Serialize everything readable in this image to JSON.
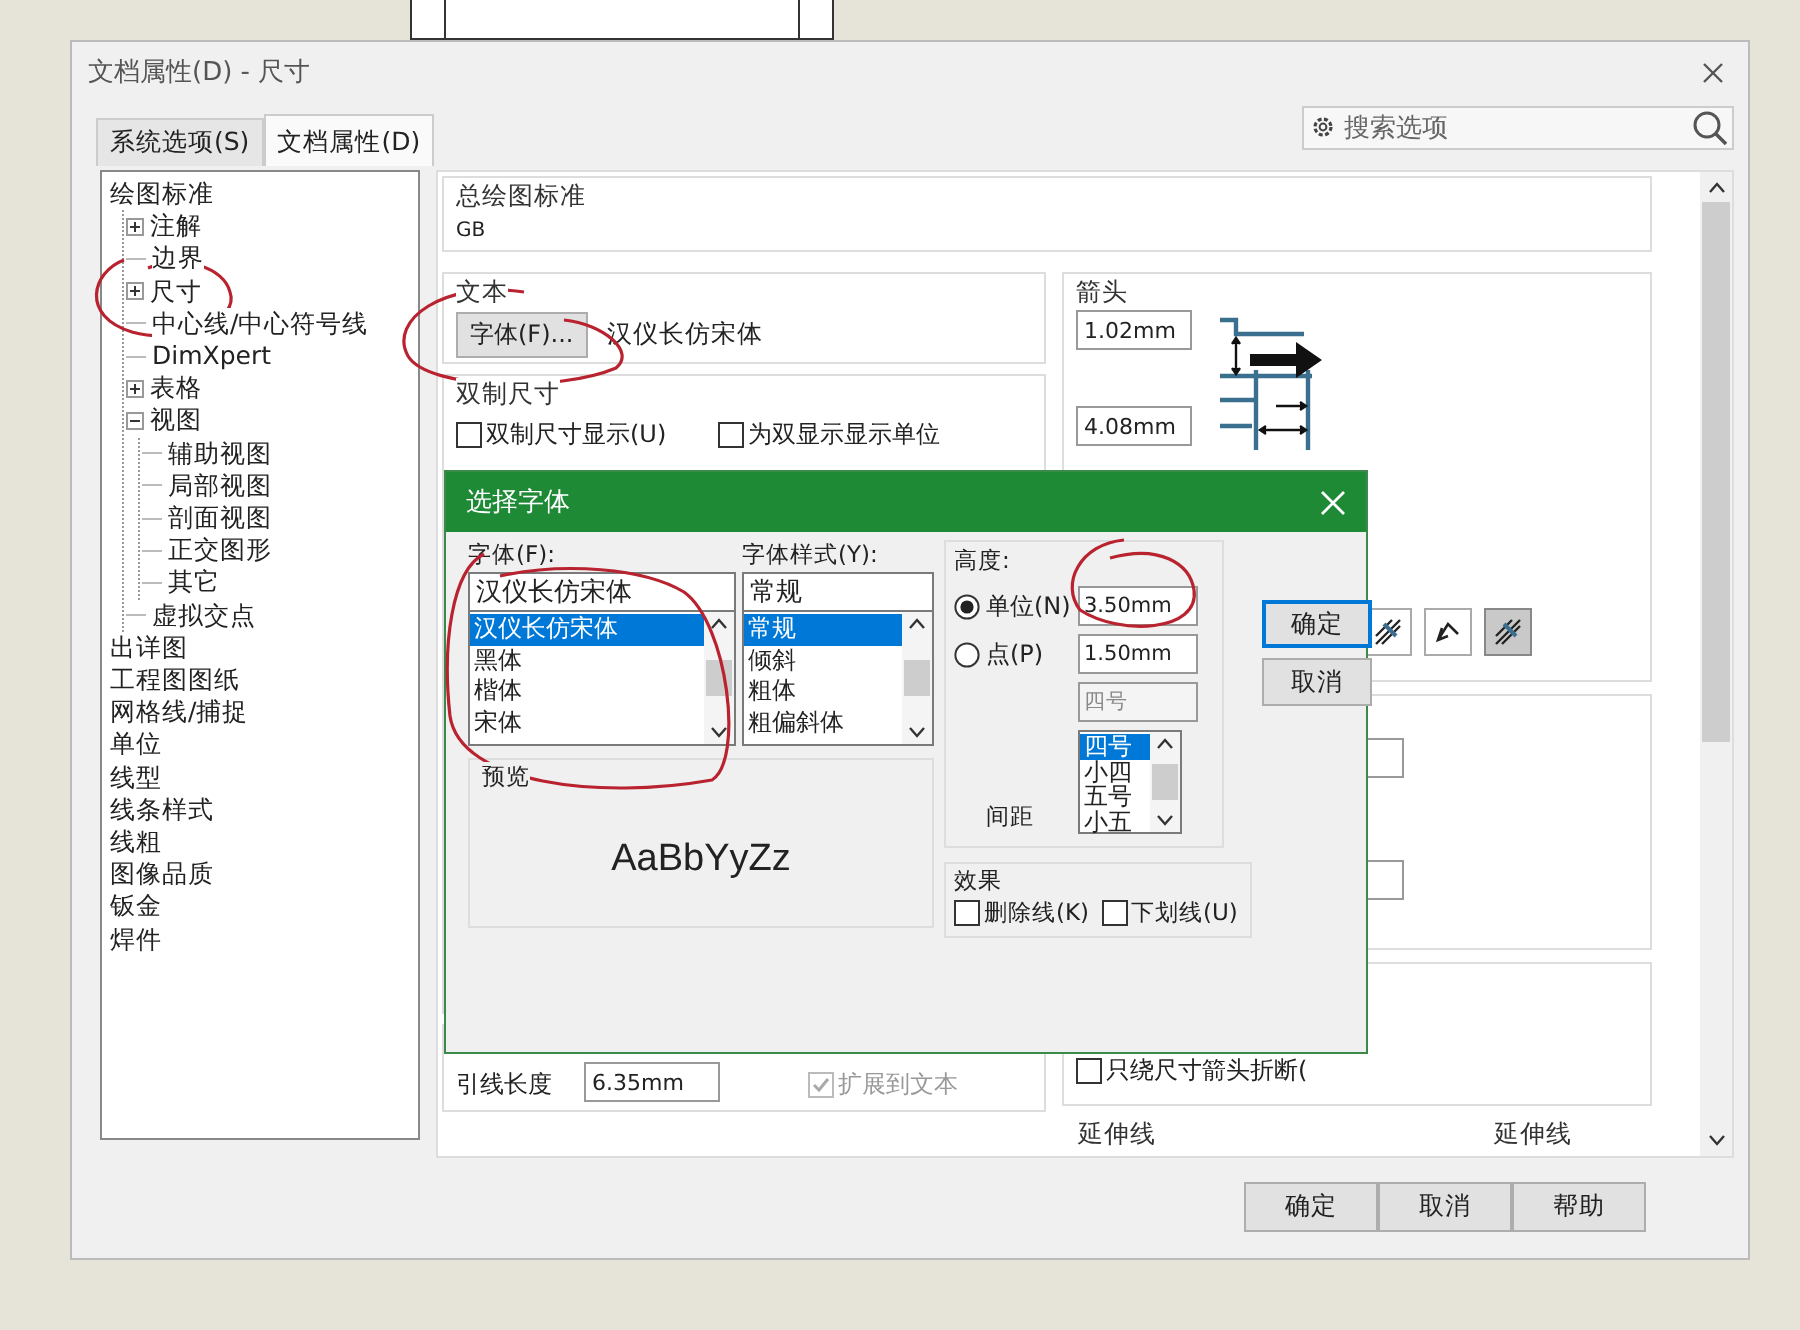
{
  "window": {
    "title": "文档属性(D) - 尺寸"
  },
  "tabs": [
    {
      "label": "系统选项(S)",
      "selected": false
    },
    {
      "label": "文档属性(D)",
      "selected": true
    }
  ],
  "search": {
    "placeholder": "搜索选项"
  },
  "tree": [
    {
      "label": "绘图标准",
      "children": [
        {
          "label": "注解",
          "expanded": false
        },
        {
          "label": "边界"
        },
        {
          "label": "尺寸",
          "expanded": false
        },
        {
          "label": "中心线/中心符号线"
        },
        {
          "label": "DimXpert"
        },
        {
          "label": "表格",
          "expanded": false
        },
        {
          "label": "视图",
          "expanded": true,
          "children": [
            {
              "label": "辅助视图"
            },
            {
              "label": "局部视图"
            },
            {
              "label": "剖面视图"
            },
            {
              "label": "正交图形"
            },
            {
              "label": "其它"
            }
          ]
        },
        {
          "label": "虚拟交点"
        }
      ]
    },
    {
      "label": "出详图"
    },
    {
      "label": "工程图图纸"
    },
    {
      "label": "网格线/捕捉"
    },
    {
      "label": "单位"
    },
    {
      "label": "线型"
    },
    {
      "label": "线条样式"
    },
    {
      "label": "线粗"
    },
    {
      "label": "图像品质"
    },
    {
      "label": "钣金"
    },
    {
      "label": "焊件"
    }
  ],
  "panel": {
    "drawing_standard": {
      "title": "总绘图标准",
      "value": "GB"
    },
    "text_group": {
      "title": "文本",
      "font_button": "字体(F)...",
      "font_name": "汉仪长仿宋体"
    },
    "dual_group": {
      "title": "双制尺寸",
      "options": [
        {
          "label": "双制尺寸显示(U)",
          "checked": false
        },
        {
          "label": "为双显示显示单位",
          "checked": false
        }
      ]
    },
    "arrows": {
      "title": "箭头",
      "fields": [
        "1.02mm",
        "4.08mm"
      ],
      "styles": [
        {
          "selected": false
        },
        {
          "selected": false
        },
        {
          "selected": true
        }
      ]
    },
    "leader": {
      "label": "引线长度",
      "value": "6.35mm",
      "extend": {
        "label": "扩展到文本",
        "checked": true,
        "disabled": true
      }
    },
    "break_option": {
      "label": "只绕尺寸箭头折断(",
      "checked": false
    },
    "extension_labels": [
      "延伸线",
      "延伸线"
    ]
  },
  "buttons": [
    {
      "label": "确定"
    },
    {
      "label": "取消"
    },
    {
      "label": "帮助"
    }
  ],
  "font_dialog": {
    "title": "选择字体",
    "font": {
      "label": "字体(F):",
      "value": "汉仪长仿宋体",
      "options": [
        {
          "label": "汉仪长仿宋体",
          "selected": true
        },
        {
          "label": "黑体",
          "selected": false
        },
        {
          "label": "楷体",
          "selected": false
        },
        {
          "label": "宋体",
          "selected": false
        }
      ]
    },
    "style": {
      "label": "字体样式(Y):",
      "value": "常规",
      "options": [
        {
          "label": "常规",
          "selected": true
        },
        {
          "label": "倾斜",
          "selected": false
        },
        {
          "label": "粗体",
          "selected": false
        },
        {
          "label": "粗偏斜体",
          "selected": false
        }
      ]
    },
    "height": {
      "label": "高度:",
      "modes": [
        {
          "label": "单位(N)",
          "selected": true,
          "value": "3.50mm"
        },
        {
          "label": "点(P)",
          "selected": false,
          "value": "1.50mm"
        }
      ],
      "size_value": "四号",
      "size_options": [
        {
          "label": "四号",
          "selected": true
        },
        {
          "label": "小四",
          "selected": false
        },
        {
          "label": "五号",
          "selected": false
        },
        {
          "label": "小五",
          "selected": false
        }
      ],
      "spacing": "间距"
    },
    "preview": {
      "label": "预览",
      "sample": "AaBbYyZz"
    },
    "effects": {
      "label": "效果",
      "options": [
        {
          "label": "删除线(K)",
          "checked": false
        },
        {
          "label": "下划线(U)",
          "checked": false
        }
      ]
    },
    "buttons": [
      {
        "label": "确定",
        "default": true
      },
      {
        "label": "取消",
        "default": false
      }
    ]
  }
}
